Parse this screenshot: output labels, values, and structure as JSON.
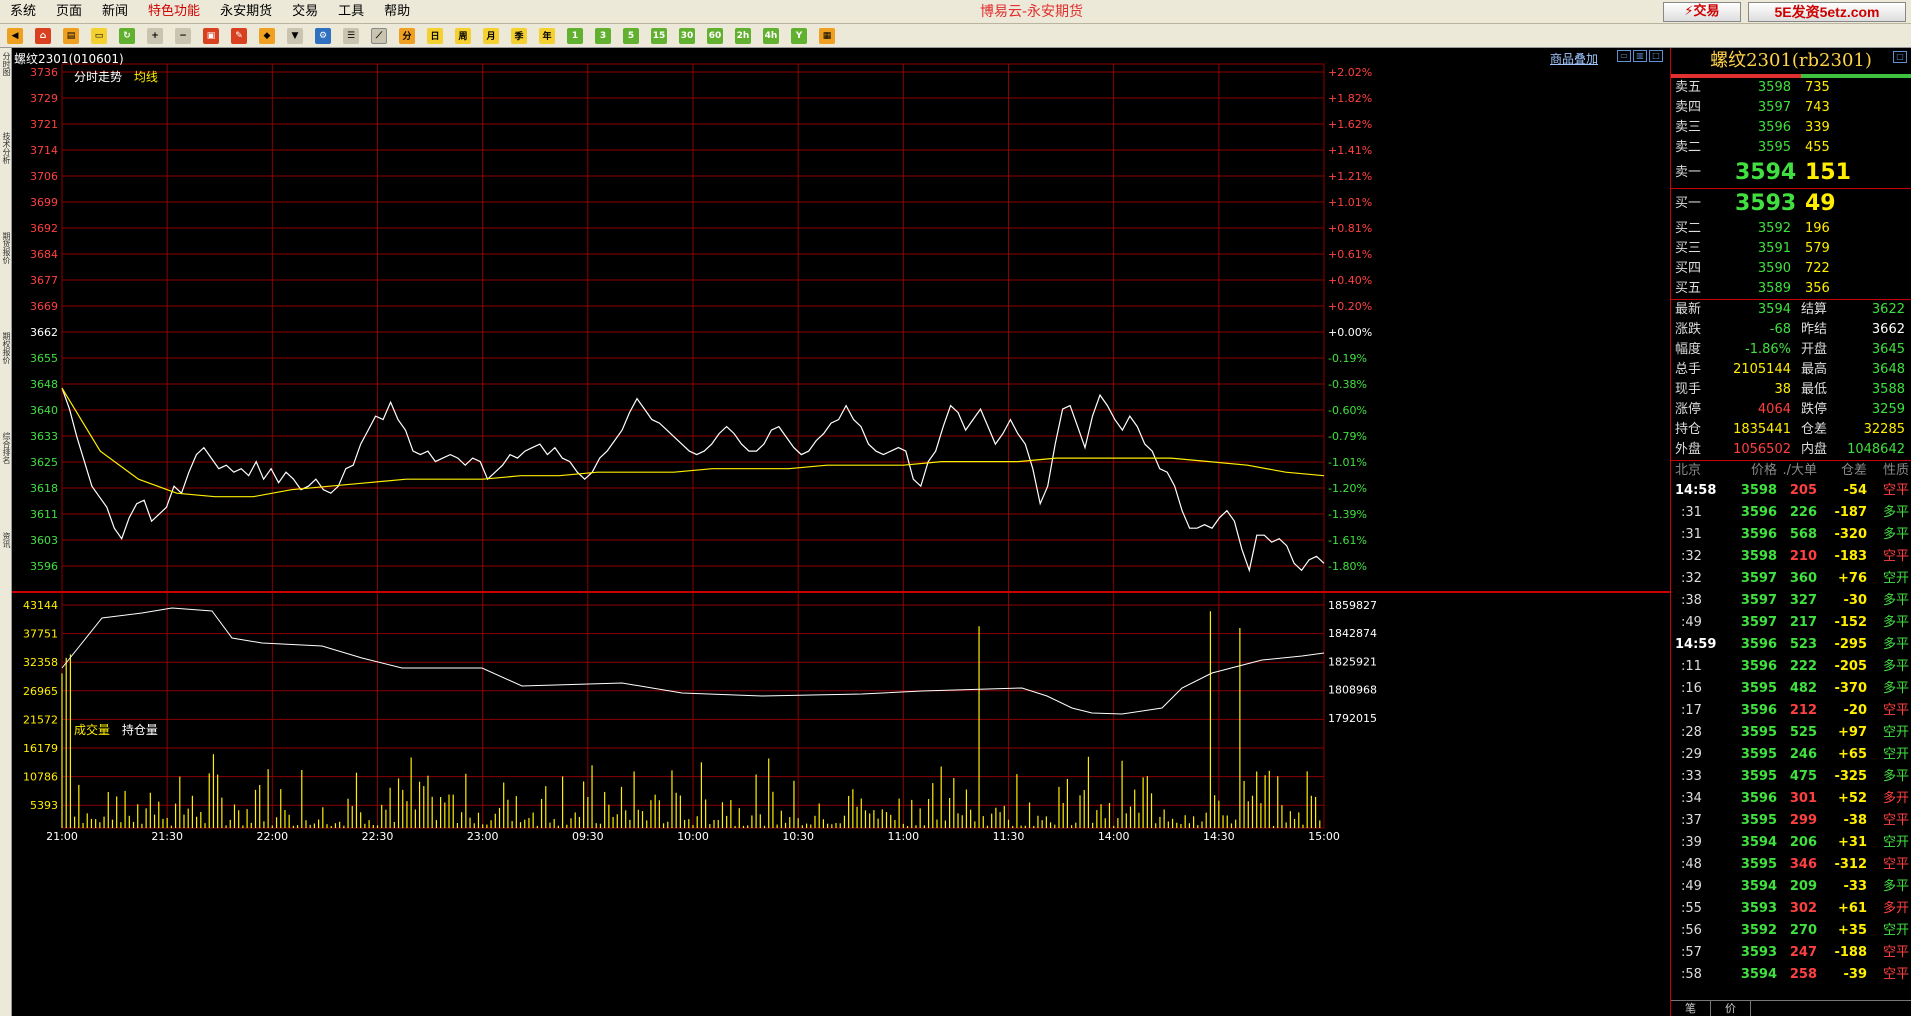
{
  "menu": {
    "items": [
      "系统",
      "页面",
      "新闻",
      "特色功能",
      "永安期货",
      "交易",
      "工具",
      "帮助"
    ],
    "highlight": "特色功能",
    "app_title": "博易云-永安期货",
    "trade_button": "⚡交易",
    "website_text": "5E发资5etz.com"
  },
  "left_tabs": [
    "分时图",
    "技术分析",
    "期货报价",
    "期权报价",
    "综合排名",
    "资讯"
  ],
  "chart": {
    "instrument": "螺纹2301(010601)",
    "overlay_link": "商品叠加",
    "legend_price": "分时走势",
    "legend_avg": "均线",
    "legend_volume": "成交量",
    "legend_oi": "持仓量",
    "price_labels": [
      "3736",
      "3729",
      "3721",
      "3714",
      "3706",
      "3699",
      "3692",
      "3684",
      "3677",
      "3669",
      "3662",
      "3655",
      "3648",
      "3640",
      "3633",
      "3625",
      "3618",
      "3611",
      "3603",
      "3596"
    ],
    "pct_labels": [
      "+2.02%",
      "+1.82%",
      "+1.62%",
      "+1.41%",
      "+1.21%",
      "+1.01%",
      "+0.81%",
      "+0.61%",
      "+0.40%",
      "+0.20%",
      "+0.00%",
      "-0.19%",
      "-0.38%",
      "-0.60%",
      "-0.79%",
      "-1.01%",
      "-1.20%",
      "-1.39%",
      "-1.61%",
      "-1.80%"
    ],
    "volume_labels": [
      "43144",
      "37751",
      "32358",
      "26965",
      "21572",
      "16179",
      "10786",
      "5393"
    ],
    "oi_labels": [
      "1859827",
      "1842874",
      "1825921",
      "1808968",
      "1792015"
    ],
    "time_labels": [
      "21:00",
      "21:30",
      "22:00",
      "22:30",
      "23:00",
      "09:30",
      "10:00",
      "10:30",
      "11:00",
      "11:30",
      "14:00",
      "14:30",
      "15:00"
    ],
    "colors": {
      "up": "#ff4040",
      "down": "#40e040",
      "grid": "#8b0000",
      "price_line": "#ffffff",
      "avg_line": "#ffee00",
      "volume": "#ffee00"
    }
  },
  "chart_data": {
    "type": "line",
    "title": "分时走势",
    "prev_settle": 3662,
    "ylim": [
      3593,
      3740
    ],
    "series": [
      {
        "name": "分时走势",
        "values": [
          3646,
          3640,
          3632,
          3625,
          3618,
          3615,
          3612,
          3606,
          3603,
          3609,
          3613,
          3614,
          3608,
          3610,
          3612,
          3618,
          3616,
          3622,
          3627,
          3629,
          3626,
          3623,
          3624,
          3622,
          3623,
          3621,
          3625,
          3620,
          3623,
          3619,
          3622,
          3620,
          3617,
          3618,
          3620,
          3617,
          3616,
          3618,
          3623,
          3624,
          3630,
          3634,
          3638,
          3637,
          3642,
          3637,
          3634,
          3628,
          3627,
          3628,
          3625,
          3626,
          3627,
          3626,
          3624,
          3626,
          3625,
          3620,
          3622,
          3624,
          3627,
          3626,
          3628,
          3629,
          3630,
          3627,
          3629,
          3626,
          3625,
          3622,
          3620,
          3622,
          3626,
          3628,
          3631,
          3634,
          3639,
          3643,
          3640,
          3637,
          3636,
          3634,
          3632,
          3630,
          3628,
          3627,
          3628,
          3630,
          3633,
          3635,
          3633,
          3630,
          3628,
          3628,
          3630,
          3634,
          3635,
          3632,
          3629,
          3627,
          3628,
          3631,
          3633,
          3636,
          3637,
          3641,
          3637,
          3635,
          3630,
          3628,
          3627,
          3628,
          3629,
          3628,
          3620,
          3618,
          3625,
          3628,
          3635,
          3641,
          3639,
          3634,
          3637,
          3640,
          3635,
          3630,
          3633,
          3637,
          3633,
          3630,
          3623,
          3613,
          3618,
          3630,
          3640,
          3641,
          3635,
          3629,
          3638,
          3644,
          3641,
          3637,
          3634,
          3638,
          3635,
          3630,
          3628,
          3623,
          3622,
          3618,
          3611,
          3606,
          3606,
          3607,
          3606,
          3609,
          3611,
          3608,
          3600,
          3594,
          3604,
          3604,
          3602,
          3603,
          3601,
          3596,
          3594,
          3597,
          3598,
          3596
        ]
      },
      {
        "name": "均线",
        "values": [
          3646,
          3628,
          3620,
          3616,
          3615,
          3615,
          3617,
          3618,
          3619,
          3620,
          3620,
          3620,
          3621,
          3621,
          3622,
          3622,
          3622,
          3623,
          3623,
          3623,
          3624,
          3624,
          3624,
          3625,
          3625,
          3625,
          3626,
          3626,
          3626,
          3626,
          3625,
          3624,
          3622,
          3621
        ]
      }
    ],
    "volume": [],
    "open_interest": []
  },
  "panel": {
    "title": "螺纹2301(rb2301)",
    "asks": [
      {
        "label": "卖五",
        "price": "3598",
        "vol": "735"
      },
      {
        "label": "卖四",
        "price": "3597",
        "vol": "743"
      },
      {
        "label": "卖三",
        "price": "3596",
        "vol": "339"
      },
      {
        "label": "卖二",
        "price": "3595",
        "vol": "455"
      }
    ],
    "ask1": {
      "label": "卖一",
      "price": "3594",
      "vol": "151"
    },
    "bid1": {
      "label": "买一",
      "price": "3593",
      "vol": "49"
    },
    "bids": [
      {
        "label": "买二",
        "price": "3592",
        "vol": "196"
      },
      {
        "label": "买三",
        "price": "3591",
        "vol": "579"
      },
      {
        "label": "买四",
        "price": "3590",
        "vol": "722"
      },
      {
        "label": "买五",
        "price": "3589",
        "vol": "356"
      }
    ],
    "quote": [
      {
        "k1": "最新",
        "v1": "3594",
        "c1": "g",
        "k2": "结算",
        "v2": "3622",
        "c2": "g"
      },
      {
        "k1": "涨跌",
        "v1": "-68",
        "c1": "g",
        "k2": "昨结",
        "v2": "3662",
        "c2": "w"
      },
      {
        "k1": "幅度",
        "v1": "-1.86%",
        "c1": "g",
        "k2": "开盘",
        "v2": "3645",
        "c2": "g"
      },
      {
        "k1": "总手",
        "v1": "2105144",
        "c1": "y",
        "k2": "最高",
        "v2": "3648",
        "c2": "g"
      },
      {
        "k1": "现手",
        "v1": "38",
        "c1": "y",
        "k2": "最低",
        "v2": "3588",
        "c2": "g"
      },
      {
        "k1": "涨停",
        "v1": "4064",
        "c1": "r",
        "k2": "跌停",
        "v2": "3259",
        "c2": "g"
      },
      {
        "k1": "持仓",
        "v1": "1835441",
        "c1": "y",
        "k2": "仓差",
        "v2": "32285",
        "c2": "y"
      },
      {
        "k1": "外盘",
        "v1": "1056502",
        "c1": "r",
        "k2": "内盘",
        "v2": "1048642",
        "c2": "g"
      }
    ],
    "ticks_header": {
      "time": "北京",
      "price": "价格",
      "vol": "./大单",
      "diff": "仓差",
      "nature": "性质"
    },
    "ticks": [
      {
        "t": "14:58",
        "hour": true,
        "p": "3598",
        "pc": "g",
        "v": "205",
        "vc": "r",
        "d": "-54",
        "dc": "y",
        "x": "空平",
        "xc": "r"
      },
      {
        "t": ":31",
        "hour": false,
        "p": "3596",
        "pc": "g",
        "v": "226",
        "vc": "g",
        "d": "-187",
        "dc": "y",
        "x": "多平",
        "xc": "g"
      },
      {
        "t": ":31",
        "hour": false,
        "p": "3596",
        "pc": "g",
        "v": "568",
        "vc": "g",
        "d": "-320",
        "dc": "y",
        "x": "多平",
        "xc": "g"
      },
      {
        "t": ":32",
        "hour": false,
        "p": "3598",
        "pc": "g",
        "v": "210",
        "vc": "r",
        "d": "-183",
        "dc": "y",
        "x": "空平",
        "xc": "r"
      },
      {
        "t": ":32",
        "hour": false,
        "p": "3597",
        "pc": "g",
        "v": "360",
        "vc": "g",
        "d": "+76",
        "dc": "y",
        "x": "空开",
        "xc": "g"
      },
      {
        "t": ":38",
        "hour": false,
        "p": "3597",
        "pc": "g",
        "v": "327",
        "vc": "g",
        "d": "-30",
        "dc": "y",
        "x": "多平",
        "xc": "g"
      },
      {
        "t": ":49",
        "hour": false,
        "p": "3597",
        "pc": "g",
        "v": "217",
        "vc": "g",
        "d": "-152",
        "dc": "y",
        "x": "多平",
        "xc": "g"
      },
      {
        "t": "14:59",
        "hour": true,
        "p": "3596",
        "pc": "g",
        "v": "523",
        "vc": "g",
        "d": "-295",
        "dc": "y",
        "x": "多平",
        "xc": "g"
      },
      {
        "t": ":11",
        "hour": false,
        "p": "3596",
        "pc": "g",
        "v": "222",
        "vc": "g",
        "d": "-205",
        "dc": "y",
        "x": "多平",
        "xc": "g"
      },
      {
        "t": ":16",
        "hour": false,
        "p": "3595",
        "pc": "g",
        "v": "482",
        "vc": "g",
        "d": "-370",
        "dc": "y",
        "x": "多平",
        "xc": "g"
      },
      {
        "t": ":17",
        "hour": false,
        "p": "3596",
        "pc": "g",
        "v": "212",
        "vc": "r",
        "d": "-20",
        "dc": "y",
        "x": "空平",
        "xc": "r"
      },
      {
        "t": ":28",
        "hour": false,
        "p": "3595",
        "pc": "g",
        "v": "525",
        "vc": "g",
        "d": "+97",
        "dc": "y",
        "x": "空开",
        "xc": "g"
      },
      {
        "t": ":29",
        "hour": false,
        "p": "3595",
        "pc": "g",
        "v": "246",
        "vc": "g",
        "d": "+65",
        "dc": "y",
        "x": "空开",
        "xc": "g"
      },
      {
        "t": ":33",
        "hour": false,
        "p": "3595",
        "pc": "g",
        "v": "475",
        "vc": "g",
        "d": "-325",
        "dc": "y",
        "x": "多平",
        "xc": "g"
      },
      {
        "t": ":34",
        "hour": false,
        "p": "3596",
        "pc": "g",
        "v": "301",
        "vc": "r",
        "d": "+52",
        "dc": "y",
        "x": "多开",
        "xc": "r"
      },
      {
        "t": ":37",
        "hour": false,
        "p": "3595",
        "pc": "g",
        "v": "299",
        "vc": "r",
        "d": "-38",
        "dc": "y",
        "x": "空平",
        "xc": "r"
      },
      {
        "t": ":39",
        "hour": false,
        "p": "3594",
        "pc": "g",
        "v": "206",
        "vc": "g",
        "d": "+31",
        "dc": "y",
        "x": "空开",
        "xc": "g"
      },
      {
        "t": ":48",
        "hour": false,
        "p": "3595",
        "pc": "g",
        "v": "346",
        "vc": "r",
        "d": "-312",
        "dc": "y",
        "x": "空平",
        "xc": "r"
      },
      {
        "t": ":49",
        "hour": false,
        "p": "3594",
        "pc": "g",
        "v": "209",
        "vc": "g",
        "d": "-33",
        "dc": "y",
        "x": "多平",
        "xc": "g"
      },
      {
        "t": ":55",
        "hour": false,
        "p": "3593",
        "pc": "g",
        "v": "302",
        "vc": "r",
        "d": "+61",
        "dc": "y",
        "x": "多开",
        "xc": "r"
      },
      {
        "t": ":56",
        "hour": false,
        "p": "3592",
        "pc": "g",
        "v": "270",
        "vc": "g",
        "d": "+35",
        "dc": "y",
        "x": "空开",
        "xc": "g"
      },
      {
        "t": ":57",
        "hour": false,
        "p": "3593",
        "pc": "g",
        "v": "247",
        "vc": "r",
        "d": "-188",
        "dc": "y",
        "x": "空平",
        "xc": "r"
      },
      {
        "t": ":58",
        "hour": false,
        "p": "3594",
        "pc": "g",
        "v": "258",
        "vc": "r",
        "d": "-39",
        "dc": "y",
        "x": "空平",
        "xc": "r"
      }
    ],
    "bottom_tabs": [
      "笔",
      "价"
    ]
  }
}
